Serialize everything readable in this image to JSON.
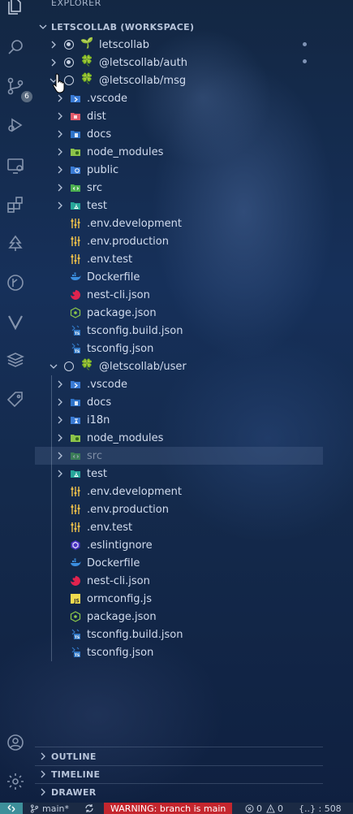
{
  "explorer": {
    "title": "EXPLORER",
    "more": "···"
  },
  "workspace": {
    "title": "LETSCOLLAB (WORKSPACE)"
  },
  "badges": {
    "source_control": "6"
  },
  "roots": [
    {
      "label": "letscollab"
    },
    {
      "label": "@letscollab/auth"
    },
    {
      "label": "@letscollab/msg"
    },
    {
      "label": "@letscollab/user"
    }
  ],
  "msg_children": [
    {
      "label": ".vscode",
      "kind": "folder",
      "icon": "vscode-folder-icon"
    },
    {
      "label": "dist",
      "kind": "folder",
      "icon": "dist-folder-icon"
    },
    {
      "label": "docs",
      "kind": "folder",
      "icon": "docs-folder-icon"
    },
    {
      "label": "node_modules",
      "kind": "folder",
      "icon": "node-modules-folder-icon"
    },
    {
      "label": "public",
      "kind": "folder",
      "icon": "public-folder-icon"
    },
    {
      "label": "src",
      "kind": "folder",
      "icon": "src-folder-icon"
    },
    {
      "label": "test",
      "kind": "folder",
      "icon": "test-folder-icon"
    },
    {
      "label": ".env.development",
      "kind": "file",
      "icon": "env-file-icon"
    },
    {
      "label": ".env.production",
      "kind": "file",
      "icon": "env-file-icon"
    },
    {
      "label": ".env.test",
      "kind": "file",
      "icon": "env-file-icon"
    },
    {
      "label": "Dockerfile",
      "kind": "file",
      "icon": "docker-icon"
    },
    {
      "label": "nest-cli.json",
      "kind": "file",
      "icon": "nest-icon"
    },
    {
      "label": "package.json",
      "kind": "file",
      "icon": "nodejs-icon"
    },
    {
      "label": "tsconfig.build.json",
      "kind": "file",
      "icon": "tsconfig-icon"
    },
    {
      "label": "tsconfig.json",
      "kind": "file",
      "icon": "tsconfig-icon"
    }
  ],
  "user_children": [
    {
      "label": ".vscode",
      "kind": "folder",
      "icon": "vscode-folder-icon"
    },
    {
      "label": "docs",
      "kind": "folder",
      "icon": "docs-folder-icon"
    },
    {
      "label": "i18n",
      "kind": "folder",
      "icon": "i18n-folder-icon"
    },
    {
      "label": "node_modules",
      "kind": "folder",
      "icon": "node-modules-folder-icon"
    },
    {
      "label": "src",
      "kind": "folder",
      "icon": "src-folder-icon",
      "selected": true
    },
    {
      "label": "test",
      "kind": "folder",
      "icon": "test-folder-icon"
    },
    {
      "label": ".env.development",
      "kind": "file",
      "icon": "env-file-icon"
    },
    {
      "label": ".env.production",
      "kind": "file",
      "icon": "env-file-icon"
    },
    {
      "label": ".env.test",
      "kind": "file",
      "icon": "env-file-icon"
    },
    {
      "label": ".eslintignore",
      "kind": "file",
      "icon": "eslint-icon"
    },
    {
      "label": "Dockerfile",
      "kind": "file",
      "icon": "docker-icon"
    },
    {
      "label": "nest-cli.json",
      "kind": "file",
      "icon": "nest-icon"
    },
    {
      "label": "ormconfig.js",
      "kind": "file",
      "icon": "js-icon"
    },
    {
      "label": "package.json",
      "kind": "file",
      "icon": "nodejs-icon"
    },
    {
      "label": "tsconfig.build.json",
      "kind": "file",
      "icon": "tsconfig-icon"
    },
    {
      "label": "tsconfig.json",
      "kind": "file",
      "icon": "tsconfig-icon"
    }
  ],
  "panels": [
    {
      "label": "OUTLINE"
    },
    {
      "label": "TIMELINE"
    },
    {
      "label": "DRAWER"
    }
  ],
  "statusbar": {
    "branch": "main*",
    "warning": "WARNING: branch is main",
    "errors": "0",
    "warnings": "0",
    "json_info": "{..} : 508"
  },
  "colors": {
    "warning_bg": "#c4262e",
    "remote_bg": "#3d8f9a",
    "clover": "#4cbf5a"
  }
}
